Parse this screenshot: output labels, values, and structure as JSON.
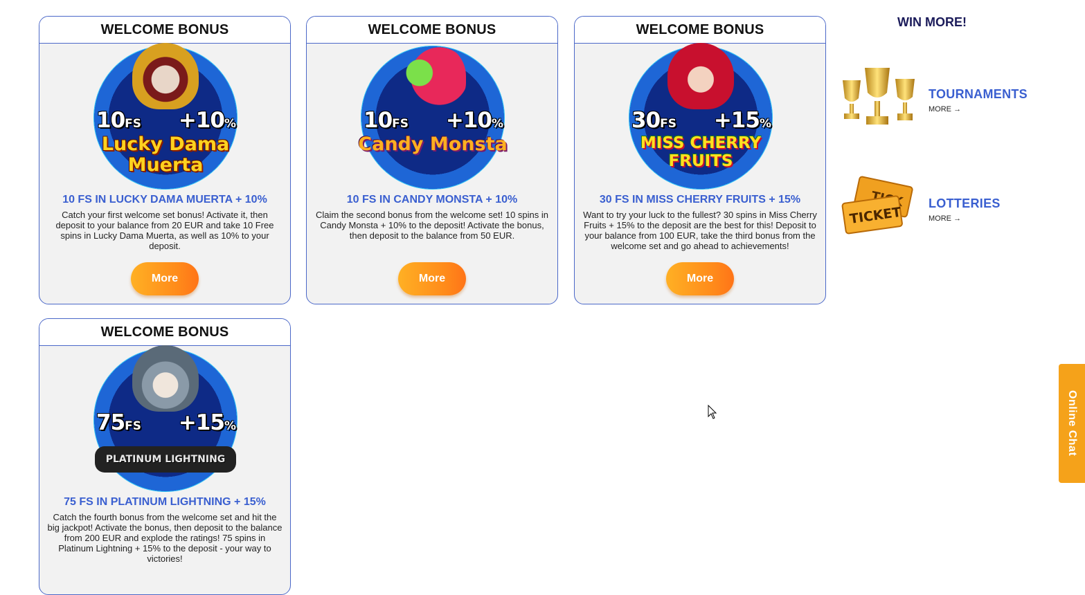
{
  "cards": [
    {
      "header": "WELCOME BONUS",
      "badge_fs": "10",
      "badge_fs_unit": "FS",
      "badge_pct": "+10",
      "badge_pct_unit": "%",
      "badge_game": "Lucky Dama Muerta",
      "title": "10 FS IN LUCKY DAMA MUERTA + 10%",
      "description": "Catch your first welcome set bonus! Activate it, then deposit to your balance from 20 EUR and take 10 Free spins in Lucky Dama Muerta, as well as 10% to your deposit.",
      "button": "More"
    },
    {
      "header": "WELCOME BONUS",
      "badge_fs": "10",
      "badge_fs_unit": "FS",
      "badge_pct": "+10",
      "badge_pct_unit": "%",
      "badge_game": "Candy Monsta",
      "title": "10 FS IN CANDY MONSTA + 10%",
      "description": "Claim the second bonus from the welcome set! 10 spins in Candy Monsta + 10% to the deposit! Activate the bonus, then deposit to the balance from 50 EUR.",
      "button": "More"
    },
    {
      "header": "WELCOME BONUS",
      "badge_fs": "30",
      "badge_fs_unit": "FS",
      "badge_pct": "+15",
      "badge_pct_unit": "%",
      "badge_game": "MISS CHERRY FRUITS",
      "title": "30 FS IN MISS CHERRY FRUITS + 15%",
      "description": "Want to try your luck to the fullest? 30 spins in Miss Cherry Fruits + 15% to the deposit are the best for this! Deposit to your balance from 100 EUR, take the third bonus from the welcome set and go ahead to achievements!",
      "button": "More"
    },
    {
      "header": "WELCOME BONUS",
      "badge_fs": "75",
      "badge_fs_unit": "FS",
      "badge_pct": "+15",
      "badge_pct_unit": "%",
      "badge_game": "PLATINUM LIGHTNING",
      "title": "75 FS IN PLATINUM LIGHTNING + 15%",
      "description": "Catch the fourth bonus from the welcome set and hit the big jackpot! Activate the bonus, then deposit to the balance from 200 EUR and explode the ratings! 75 spins in Platinum Lightning + 15% to the deposit - your way to victories!",
      "button": "More"
    }
  ],
  "sidebar": {
    "title": "WIN MORE!",
    "items": [
      {
        "label": "TOURNAMENTS",
        "more": "MORE",
        "icon": "trophies-icon"
      },
      {
        "label": "LOTTERIES",
        "more": "MORE",
        "icon": "tickets-icon"
      }
    ]
  },
  "chat": {
    "label": "Online Chat"
  },
  "colors": {
    "accent": "#3a5fd0",
    "button": "#ff8a1a",
    "chat": "#f5a21a",
    "border": "#4a67c8"
  }
}
